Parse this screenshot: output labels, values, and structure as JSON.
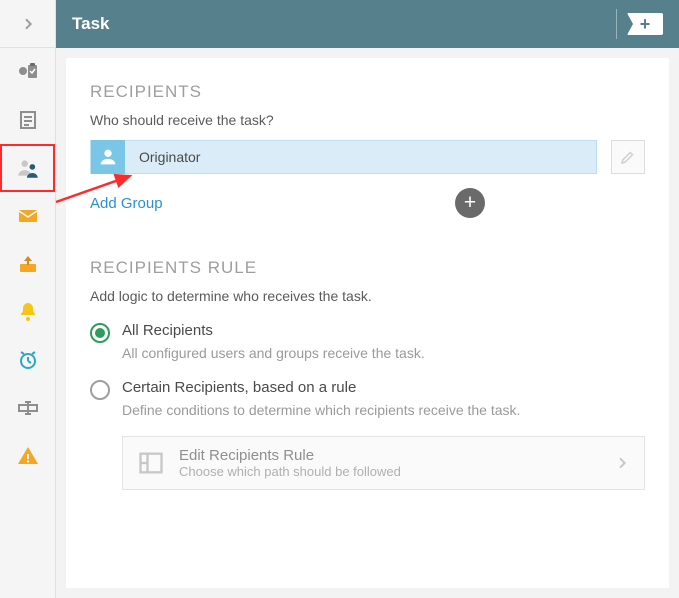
{
  "header": {
    "title": "Task"
  },
  "recipients": {
    "section_title": "RECIPIENTS",
    "subtitle": "Who should receive the task?",
    "item_label": "Originator",
    "add_group_label": "Add Group"
  },
  "rule": {
    "section_title": "RECIPIENTS RULE",
    "description": "Add logic to determine who receives the task.",
    "option_all_label": "All Recipients",
    "option_all_help": "All configured users and groups receive the task.",
    "option_certain_label": "Certain Recipients, based on a rule",
    "option_certain_help": "Define conditions to determine which recipients receive the task.",
    "edit_rule_title": "Edit Recipients Rule",
    "edit_rule_help": "Choose which path should be followed"
  },
  "sidebar": {
    "items": [
      {
        "name": "checklist"
      },
      {
        "name": "document"
      },
      {
        "name": "recipients"
      },
      {
        "name": "mail"
      },
      {
        "name": "outbox"
      },
      {
        "name": "bell"
      },
      {
        "name": "clock"
      },
      {
        "name": "field"
      },
      {
        "name": "warning"
      }
    ]
  }
}
